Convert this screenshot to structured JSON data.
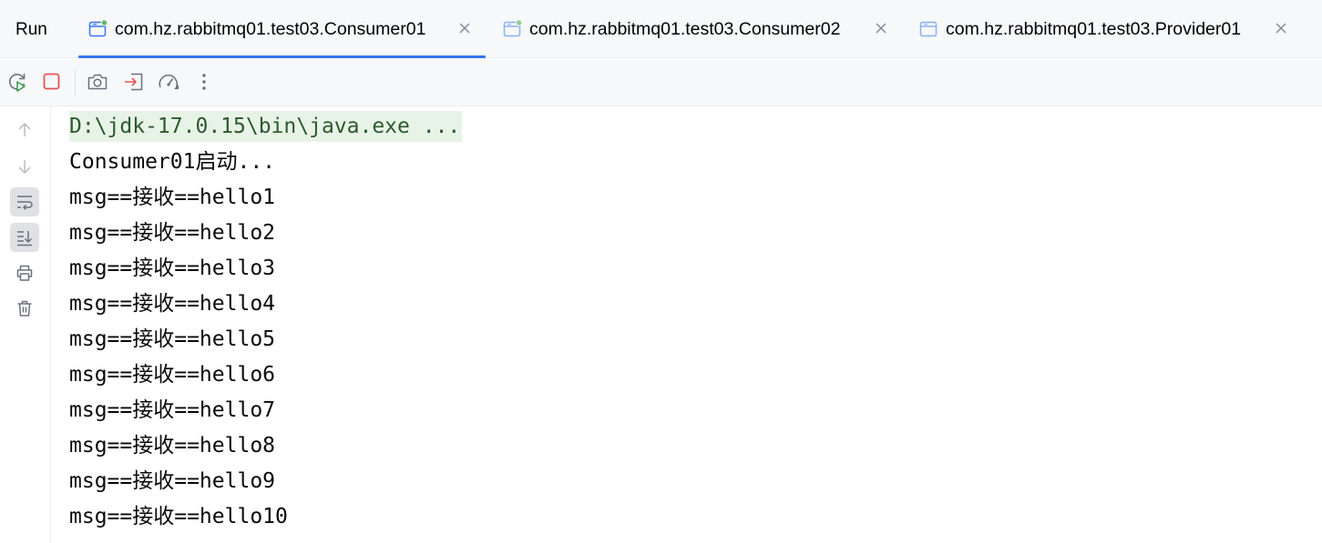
{
  "run_panel": {
    "title": "Run",
    "tabs": [
      {
        "label": "com.hz.rabbitmq01.test03.Consumer01",
        "active": true,
        "running": true
      },
      {
        "label": "com.hz.rabbitmq01.test03.Consumer02",
        "active": false,
        "running": true
      },
      {
        "label": "com.hz.rabbitmq01.test03.Provider01",
        "active": false,
        "running": false
      }
    ]
  },
  "toolbar": {
    "buttons": [
      "rerun-icon",
      "stop-icon",
      "camera-icon",
      "exit-icon",
      "profiler-icon",
      "more-vertical-icon"
    ]
  },
  "gutter": {
    "buttons": [
      "arrow-up-icon",
      "arrow-down-icon",
      "soft-wrap-icon",
      "scroll-to-end-icon",
      "print-icon",
      "trash-icon"
    ]
  },
  "console": {
    "lines": [
      "D:\\jdk-17.0.15\\bin\\java.exe ...",
      "Consumer01启动...",
      "msg==接收==hello1",
      "msg==接收==hello2",
      "msg==接收==hello3",
      "msg==接收==hello4",
      "msg==接收==hello5",
      "msg==接收==hello6",
      "msg==接收==hello7",
      "msg==接收==hello8",
      "msg==接收==hello9",
      "msg==接收==hello10"
    ]
  },
  "colors": {
    "accent": "#3574f0",
    "stop": "#e55353",
    "running_dot": "#5fb865",
    "command_line_bg": "#e8f3e8"
  }
}
